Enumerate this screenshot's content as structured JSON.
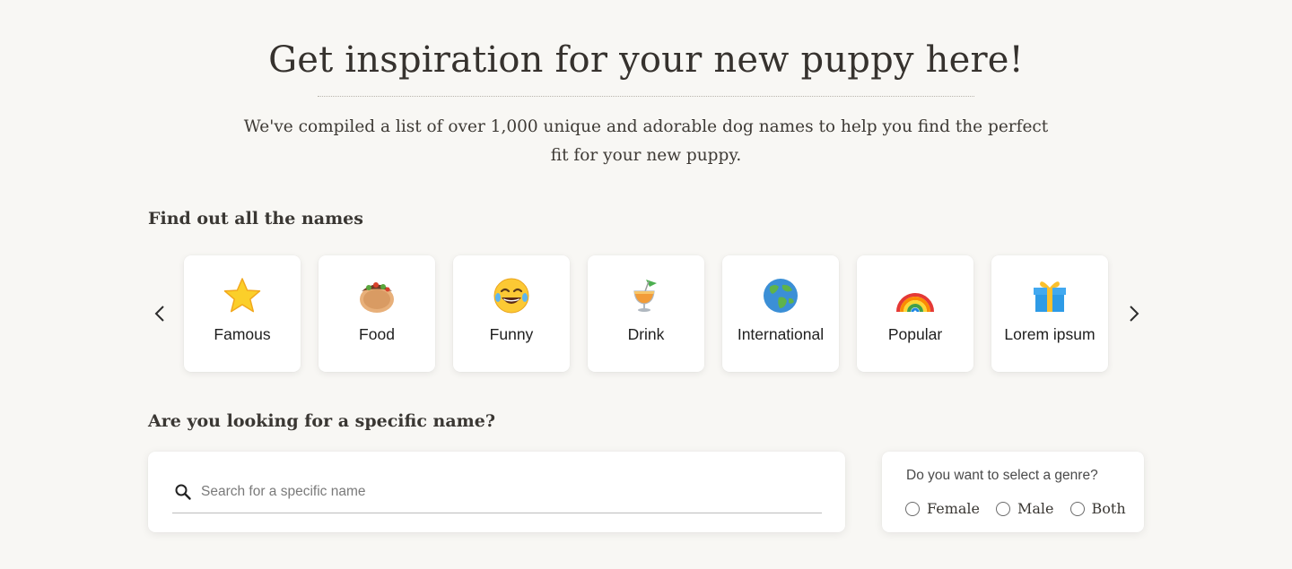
{
  "hero": {
    "title": "Get inspiration for your new puppy here!",
    "subtitle": "We've compiled a list of over 1,000 unique and adorable dog names to help you find the perfect fit for your new puppy."
  },
  "categories_section": {
    "title": "Find out all the names",
    "prev_icon": "chevron-left-icon",
    "next_icon": "chevron-right-icon",
    "items": [
      {
        "label": "Famous",
        "icon": "star-icon"
      },
      {
        "label": "Food",
        "icon": "burrito-icon"
      },
      {
        "label": "Funny",
        "icon": "laughing-face-icon"
      },
      {
        "label": "Drink",
        "icon": "tropical-drink-icon"
      },
      {
        "label": "International",
        "icon": "globe-icon"
      },
      {
        "label": "Popular",
        "icon": "rainbow-icon"
      },
      {
        "label": "Lorem ipsum",
        "icon": "gift-icon"
      }
    ]
  },
  "search_section": {
    "title": "Are you looking for a specific name?",
    "search_placeholder": "Search for a specific name",
    "search_value": "",
    "search_icon": "search-icon"
  },
  "genre": {
    "question": "Do you want to select a genre?",
    "options": [
      "Female",
      "Male",
      "Both"
    ],
    "selected": ""
  },
  "colors": {
    "background": "#f8f7f4",
    "card": "#ffffff",
    "text": "#3a3733"
  }
}
